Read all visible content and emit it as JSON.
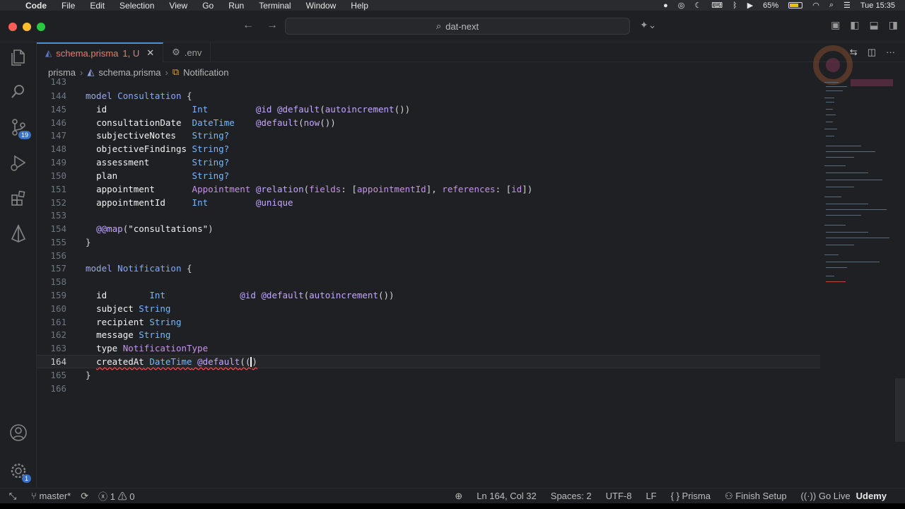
{
  "menubar": {
    "app": "Code",
    "items": [
      "File",
      "Edit",
      "Selection",
      "View",
      "Go",
      "Run",
      "Terminal",
      "Window",
      "Help"
    ],
    "battery": "65%",
    "battery_level": 0.65,
    "clock": "Tue 15:35"
  },
  "window": {
    "search": "dat-next"
  },
  "activity": {
    "scm_badge": "19",
    "settings_badge": "1"
  },
  "tabs": [
    {
      "label": "schema.prisma",
      "status": "1, U"
    },
    {
      "label": ".env"
    }
  ],
  "breadcrumb": [
    "prisma",
    "schema.prisma",
    "Notification"
  ],
  "editor": {
    "current_line": 164,
    "lines": [
      {
        "n": "143",
        "text": ""
      },
      {
        "n": "144",
        "text": "model Consultation {"
      },
      {
        "n": "145",
        "text": "id Int @id @default(autoincrement())"
      },
      {
        "n": "146",
        "text": "consultationDate DateTime @default(now())"
      },
      {
        "n": "147",
        "text": "subjectiveNotes String?"
      },
      {
        "n": "148",
        "text": "objectiveFindings String?"
      },
      {
        "n": "149",
        "text": "assessment String?"
      },
      {
        "n": "150",
        "text": "plan String?"
      },
      {
        "n": "151",
        "text": "appointment Appointment @relation(fields: [appointmentId], references: [id])"
      },
      {
        "n": "152",
        "text": "appointmentId Int @unique"
      },
      {
        "n": "153",
        "text": ""
      },
      {
        "n": "154",
        "text": "@@map(\"consultations\")"
      },
      {
        "n": "155",
        "text": "}"
      },
      {
        "n": "156",
        "text": ""
      },
      {
        "n": "157",
        "text": "model Notification {"
      },
      {
        "n": "158",
        "text": ""
      },
      {
        "n": "159",
        "text": "id Int @id @default(autoincrement())"
      },
      {
        "n": "160",
        "text": "subject String"
      },
      {
        "n": "161",
        "text": "recipient String"
      },
      {
        "n": "162",
        "text": "message String"
      },
      {
        "n": "163",
        "text": "type NotificationType"
      },
      {
        "n": "164",
        "text": "createdAt DateTime @default(()"
      },
      {
        "n": "165",
        "text": "}"
      },
      {
        "n": "166",
        "text": ""
      }
    ]
  },
  "statusbar": {
    "branch": "master*",
    "errors": "1",
    "warnings": "0",
    "position": "Ln 164, Col 32",
    "spaces": "Spaces: 2",
    "encoding": "UTF-8",
    "eol": "LF",
    "language": "Prisma",
    "finish_setup": "Finish Setup",
    "go_live": "Go Live",
    "watermark": "Udemy"
  }
}
